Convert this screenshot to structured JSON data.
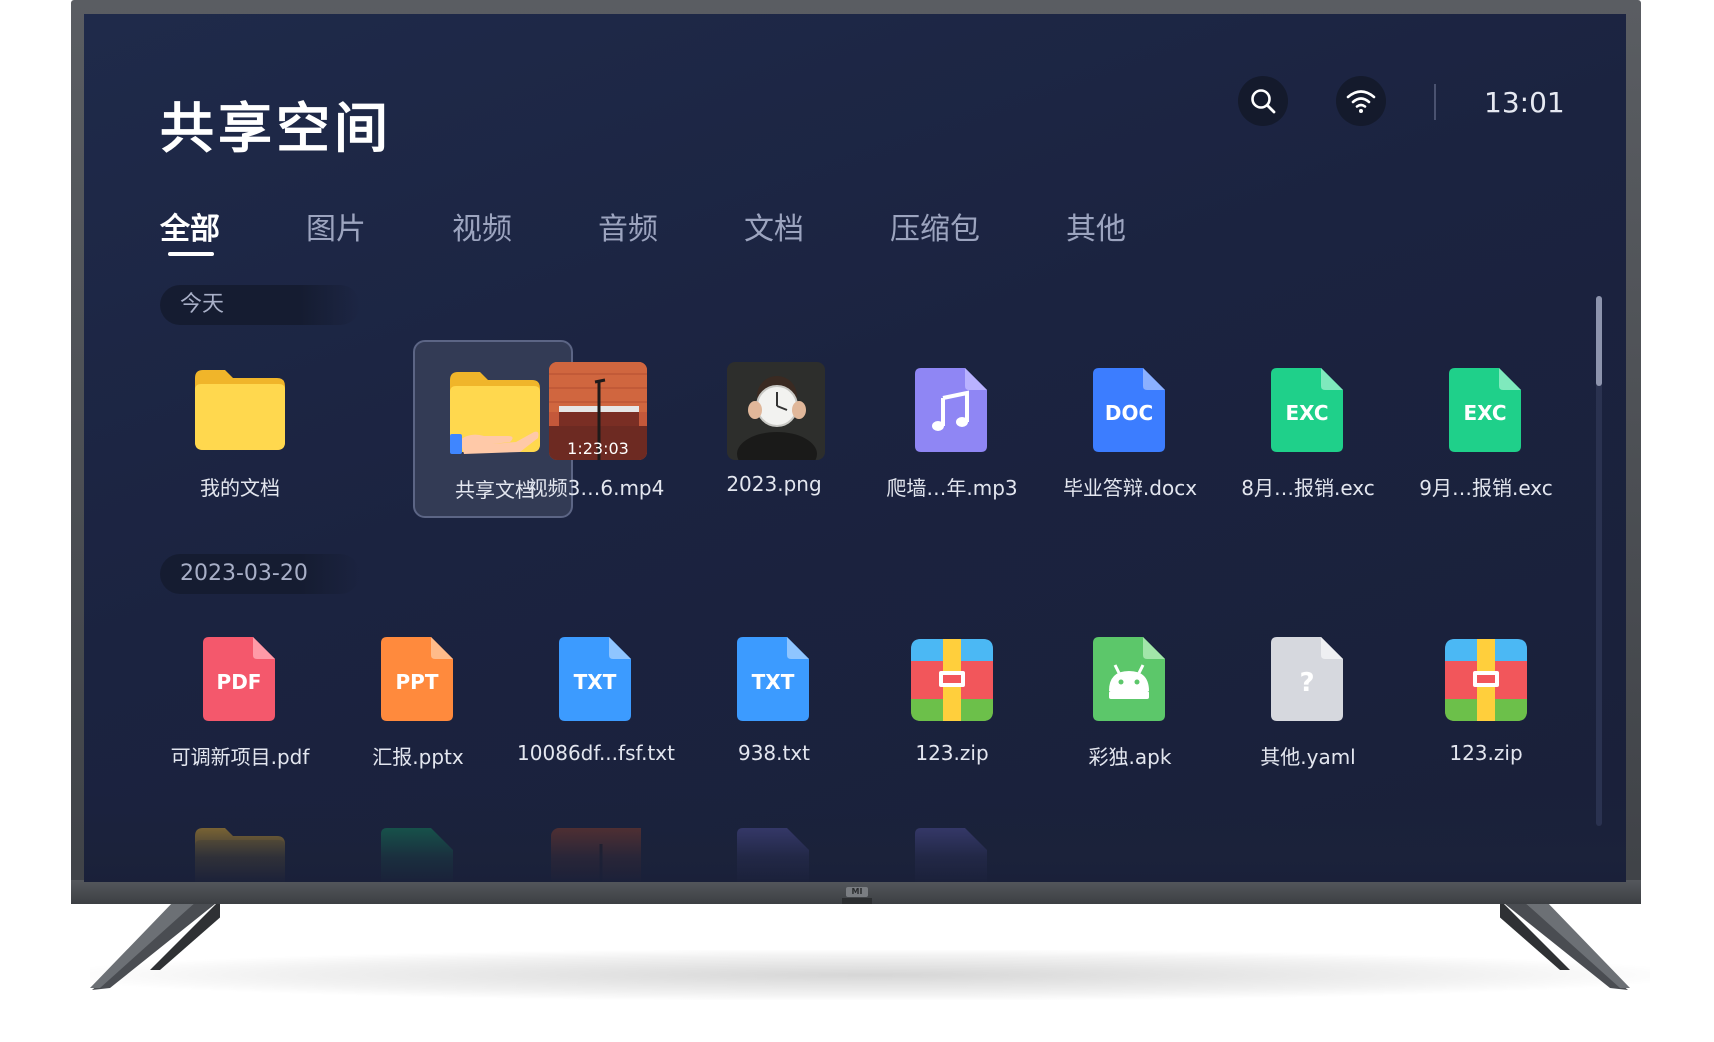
{
  "header": {
    "title": "共享空间",
    "clock": "13:01"
  },
  "tabs": [
    {
      "label": "全部",
      "active": true
    },
    {
      "label": "图片"
    },
    {
      "label": "视频"
    },
    {
      "label": "音频"
    },
    {
      "label": "文档"
    },
    {
      "label": "压缩包"
    },
    {
      "label": "其他"
    }
  ],
  "sections": [
    {
      "label": "今天",
      "files": [
        {
          "name": "我的文档",
          "icon": "folder-icon"
        },
        {
          "name": "共享文档",
          "icon": "shared-folder-icon"
        },
        {
          "name": "视频3…6.mp4",
          "icon": "video-thumbnail",
          "duration": "1:23:03"
        },
        {
          "name": "2023.png",
          "icon": "image-thumbnail"
        },
        {
          "name": "爬墙…年.mp3",
          "icon": "music-file-icon"
        },
        {
          "name": "毕业答辩.docx",
          "icon": "doc-file-icon",
          "badge": "DOC"
        },
        {
          "name": "8月…报销.exc",
          "icon": "exc-file-icon",
          "badge": "EXC"
        },
        {
          "name": "9月…报销.exc",
          "icon": "exc-file-icon",
          "badge": "EXC"
        }
      ]
    },
    {
      "label": "2023-03-20",
      "files": [
        {
          "name": "可调新项目.pdf",
          "icon": "pdf-file-icon",
          "badge": "PDF"
        },
        {
          "name": "汇报.pptx",
          "icon": "ppt-file-icon",
          "badge": "PPT"
        },
        {
          "name": "10086df...fsf.txt",
          "icon": "txt-file-icon",
          "badge": "TXT"
        },
        {
          "name": "938.txt",
          "icon": "txt-file-icon",
          "badge": "TXT"
        },
        {
          "name": "123.zip",
          "icon": "zip-file-icon"
        },
        {
          "name": "彩独.apk",
          "icon": "apk-file-icon"
        },
        {
          "name": "其他.yaml",
          "icon": "unknown-file-icon",
          "badge": "?"
        },
        {
          "name": "123.zip",
          "icon": "zip-file-icon"
        }
      ]
    }
  ],
  "colors": {
    "pdf": "#f4586c",
    "ppt": "#ff8a3d",
    "txt": "#3c9bff",
    "doc": "#3c7dff",
    "exc": "#1fd08a",
    "music": "#8f86f4",
    "apk": "#5cc76a",
    "unknown": "#d6d8de",
    "folder": "#ffd84e"
  },
  "brand": "MI"
}
